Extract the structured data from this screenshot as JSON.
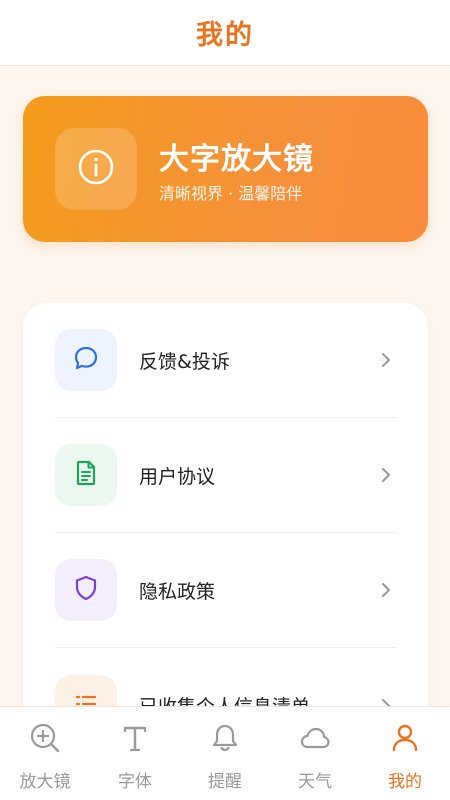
{
  "header": {
    "title": "我的"
  },
  "banner": {
    "icon": "info-icon",
    "title": "大字放大镜",
    "subtitle": "清晰视界 · 温馨陪伴"
  },
  "menu": {
    "items": [
      {
        "label": "反馈&投诉",
        "icon": "chat-bubble-icon",
        "color": "#2f6fe0",
        "bg": "#eef4ff"
      },
      {
        "label": "用户协议",
        "icon": "document-icon",
        "color": "#1fa45a",
        "bg": "#ebf8f0"
      },
      {
        "label": "隐私政策",
        "icon": "shield-icon",
        "color": "#7b3fd6",
        "bg": "#f4eefc"
      },
      {
        "label": "已收集个人信息清单",
        "icon": "list-icon",
        "color": "#e9731f",
        "bg": "#fdf1e6"
      }
    ]
  },
  "tabbar": {
    "active_color": "#e9731f",
    "inactive_color": "#9a9a9a",
    "tabs": [
      {
        "label": "放大镜",
        "icon": "zoom-in-icon",
        "active": false
      },
      {
        "label": "字体",
        "icon": "font-icon",
        "active": false
      },
      {
        "label": "提醒",
        "icon": "bell-icon",
        "active": false
      },
      {
        "label": "天气",
        "icon": "cloud-icon",
        "active": false
      },
      {
        "label": "我的",
        "icon": "user-icon",
        "active": true
      }
    ]
  }
}
